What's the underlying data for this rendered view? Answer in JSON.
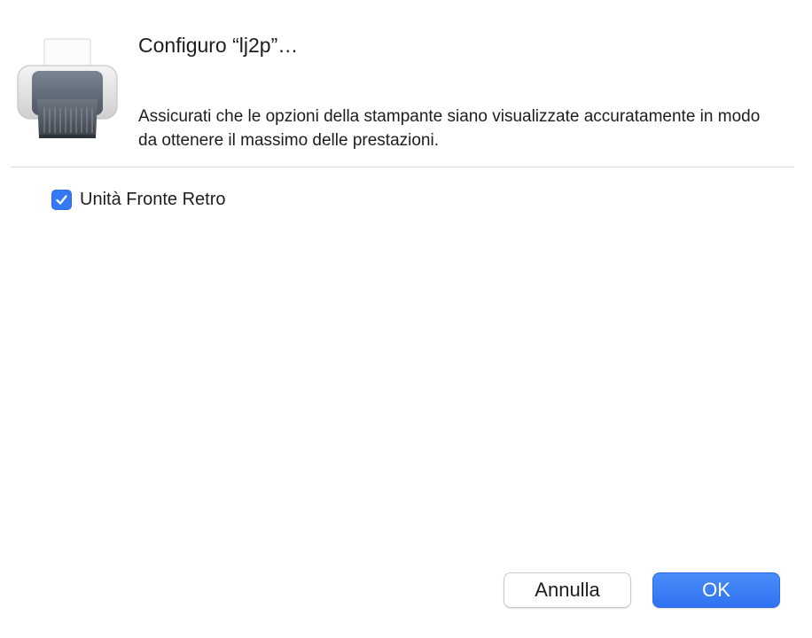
{
  "dialog": {
    "title": "Configuro “lj2p”…",
    "description": "Assicurati che le opzioni della stampante siano visualizzate accuratamente in modo da ottenere il massimo delle prestazioni.",
    "icon": "printer-icon"
  },
  "options": [
    {
      "label": "Unità Fronte Retro",
      "checked": true
    }
  ],
  "buttons": {
    "cancel_label": "Annulla",
    "ok_label": "OK"
  },
  "colors": {
    "accent": "#3478f6",
    "ok_button": "#3a7ef6"
  }
}
